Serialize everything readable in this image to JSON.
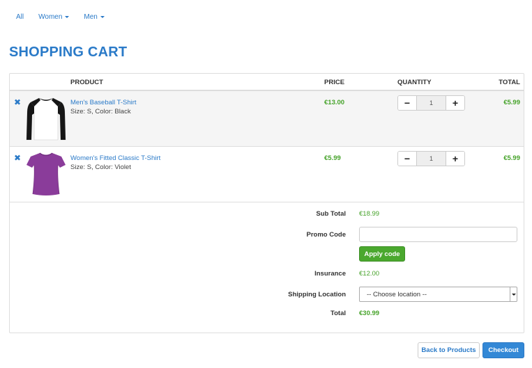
{
  "nav": {
    "items": [
      {
        "label": "All",
        "has_caret": false
      },
      {
        "label": "Women",
        "has_caret": true
      },
      {
        "label": "Men",
        "has_caret": true
      }
    ]
  },
  "page": {
    "title": "SHOPPING CART"
  },
  "cart": {
    "headers": {
      "product": "PRODUCT",
      "price": "PRICE",
      "quantity": "QUANTITY",
      "total": "TOTAL"
    },
    "items": [
      {
        "name": "Men's Baseball T-Shirt",
        "attrs": "Size: S, Color: Black",
        "price": "€13.00",
        "quantity": "1",
        "total": "€5.99",
        "image": "baseball-tshirt-black-white"
      },
      {
        "name": "Women's Fitted Classic T-Shirt",
        "attrs": "Size: S, Color: Violet",
        "price": "€5.99",
        "quantity": "1",
        "total": "€5.99",
        "image": "fitted-tshirt-violet"
      }
    ],
    "stepper": {
      "minus": "−",
      "plus": "+"
    },
    "remove_glyph": "✖"
  },
  "summary": {
    "subtotal_label": "Sub Total",
    "subtotal_value": "€18.99",
    "promo_label": "Promo Code",
    "promo_value": "",
    "apply_label": "Apply code",
    "insurance_label": "Insurance",
    "insurance_value": "€12.00",
    "shipping_label": "Shipping Location",
    "shipping_selected": "-- Choose location --",
    "total_label": "Total",
    "total_value": "€30.99"
  },
  "actions": {
    "back_label": "Back to Products",
    "checkout_label": "Checkout"
  },
  "colors": {
    "accent": "#2a7ac8",
    "price_green": "#46a32a",
    "apply_green": "#4aa82e",
    "violet": "#8a3c9a"
  }
}
